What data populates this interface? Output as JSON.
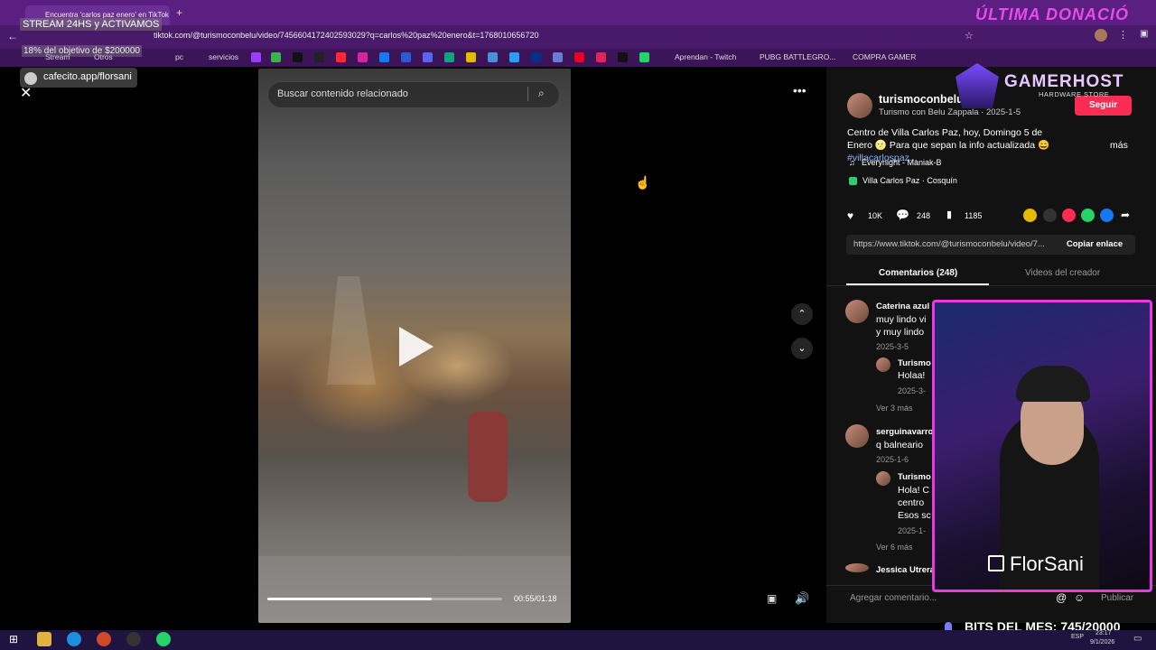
{
  "browser": {
    "tab_title": "Encuentra 'carlos paz enero' en TikTok",
    "url": "tiktok.com/@turismoconbelu/video/7456604172402593029?q=carlos%20paz%20enero&t=1768010656720",
    "bookmarks": [
      "Stream",
      "Otros",
      "pc",
      "servicios",
      "Aprendan - Twitch",
      "PUBG BATTLEGRO...",
      "COMPRA GAMER"
    ]
  },
  "stream_overlay": {
    "header": "ÚLTIMA DONACIÓ",
    "stream24": "STREAM 24HS y ACTIVAMOS",
    "objective": "18% del objetivo de $200000",
    "cafecito": "cafecito.app/florsani",
    "sponsor": "GAMERHOST",
    "sponsor_sub": "HARDWARE STORE",
    "streamer": "FlorSani",
    "bits_label": "BITS DEL MES:",
    "bits_value": "745/20000"
  },
  "video": {
    "search_placeholder": "Buscar contenido relacionado",
    "time": "00:55/01:18",
    "progress": 0.7
  },
  "post": {
    "username": "turismoconbelu",
    "meta": "Turismo con Belu Zappala · 2025-1-5",
    "follow": "Seguir",
    "caption": "Centro de Villa Carlos Paz, hoy, Domingo 5 de Enero 🌝 Para que sepan la info actualizada 😄",
    "hashtag": "#villacarlospaz...",
    "more": "más",
    "music": "Everynight - Maniak-B",
    "location": "Villa Carlos Paz · Cosquín",
    "likes": "10K",
    "comments": "248",
    "saves": "1185",
    "link": "https://www.tiktok.com/@turismoconbelu/video/7...",
    "copy": "Copiar enlace",
    "tab_comments": "Comentarios (248)",
    "tab_videos": "Videos del creador",
    "add_comment": "Agregar comentario...",
    "publish": "Publicar"
  },
  "comments": [
    {
      "user": "Caterina azul",
      "text1": "muy lindo vi",
      "text2": "y muy lindo",
      "date": "2025-3-5",
      "reply_user": "Turismo",
      "reply_text": "Holaa!",
      "reply_date": "2025-3-",
      "more": "Ver 3 más"
    },
    {
      "user": "serguinavarro",
      "text1": "q balneario",
      "text2": "",
      "date": "2025-1-6",
      "reply_user": "Turismo",
      "reply_text": "Hola! C",
      "reply_text2": "centro",
      "reply_text3": "Esos sc",
      "reply_date": "2025-1-",
      "more": "Ver 6 más"
    },
    {
      "user": "Jessica Utrera",
      "text1": "",
      "text2": "",
      "date": "",
      "reply_user": "",
      "reply_text": "",
      "reply_date": "",
      "more": ""
    }
  ],
  "taskbar": {
    "lang": "ESP",
    "time": "23:17",
    "date": "9/1/2026"
  }
}
